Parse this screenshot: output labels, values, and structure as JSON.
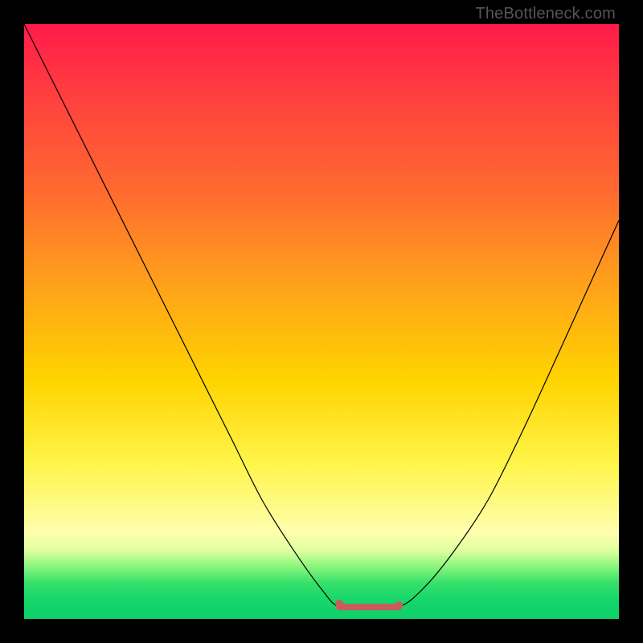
{
  "watermark": "TheBottleneck.com",
  "chart_data": {
    "type": "line",
    "title": "",
    "xlabel": "",
    "ylabel": "",
    "xlim": [
      0,
      1
    ],
    "ylim": [
      0,
      1
    ],
    "grid": false,
    "legend": false,
    "series": [
      {
        "name": "bottleneck-curve",
        "x": [
          0.0,
          0.05,
          0.1,
          0.15,
          0.2,
          0.25,
          0.3,
          0.35,
          0.4,
          0.45,
          0.5,
          0.53,
          0.58,
          0.63,
          0.67,
          0.72,
          0.78,
          0.84,
          0.9,
          0.95,
          1.0
        ],
        "values": [
          1.0,
          0.9,
          0.8,
          0.7,
          0.6,
          0.5,
          0.4,
          0.3,
          0.2,
          0.12,
          0.05,
          0.02,
          0.02,
          0.02,
          0.05,
          0.11,
          0.2,
          0.32,
          0.45,
          0.56,
          0.67
        ]
      }
    ],
    "annotations": [
      {
        "name": "optimal-flat-segment",
        "x_start": 0.53,
        "x_end": 0.63,
        "y": 0.02,
        "color": "#cc5a5a"
      }
    ],
    "background_gradient": {
      "direction": "vertical",
      "stops": [
        {
          "pos": 0.0,
          "color": "#ff1b4a"
        },
        {
          "pos": 0.12,
          "color": "#ff3f3f"
        },
        {
          "pos": 0.28,
          "color": "#ff6a2f"
        },
        {
          "pos": 0.44,
          "color": "#ffa21a"
        },
        {
          "pos": 0.6,
          "color": "#ffd400"
        },
        {
          "pos": 0.74,
          "color": "#fff54a"
        },
        {
          "pos": 0.855,
          "color": "#fffeae"
        },
        {
          "pos": 0.885,
          "color": "#dfff9e"
        },
        {
          "pos": 0.91,
          "color": "#90f77e"
        },
        {
          "pos": 0.94,
          "color": "#35e06a"
        },
        {
          "pos": 0.97,
          "color": "#14d66b"
        },
        {
          "pos": 1.0,
          "color": "#0fd06a"
        }
      ]
    }
  }
}
